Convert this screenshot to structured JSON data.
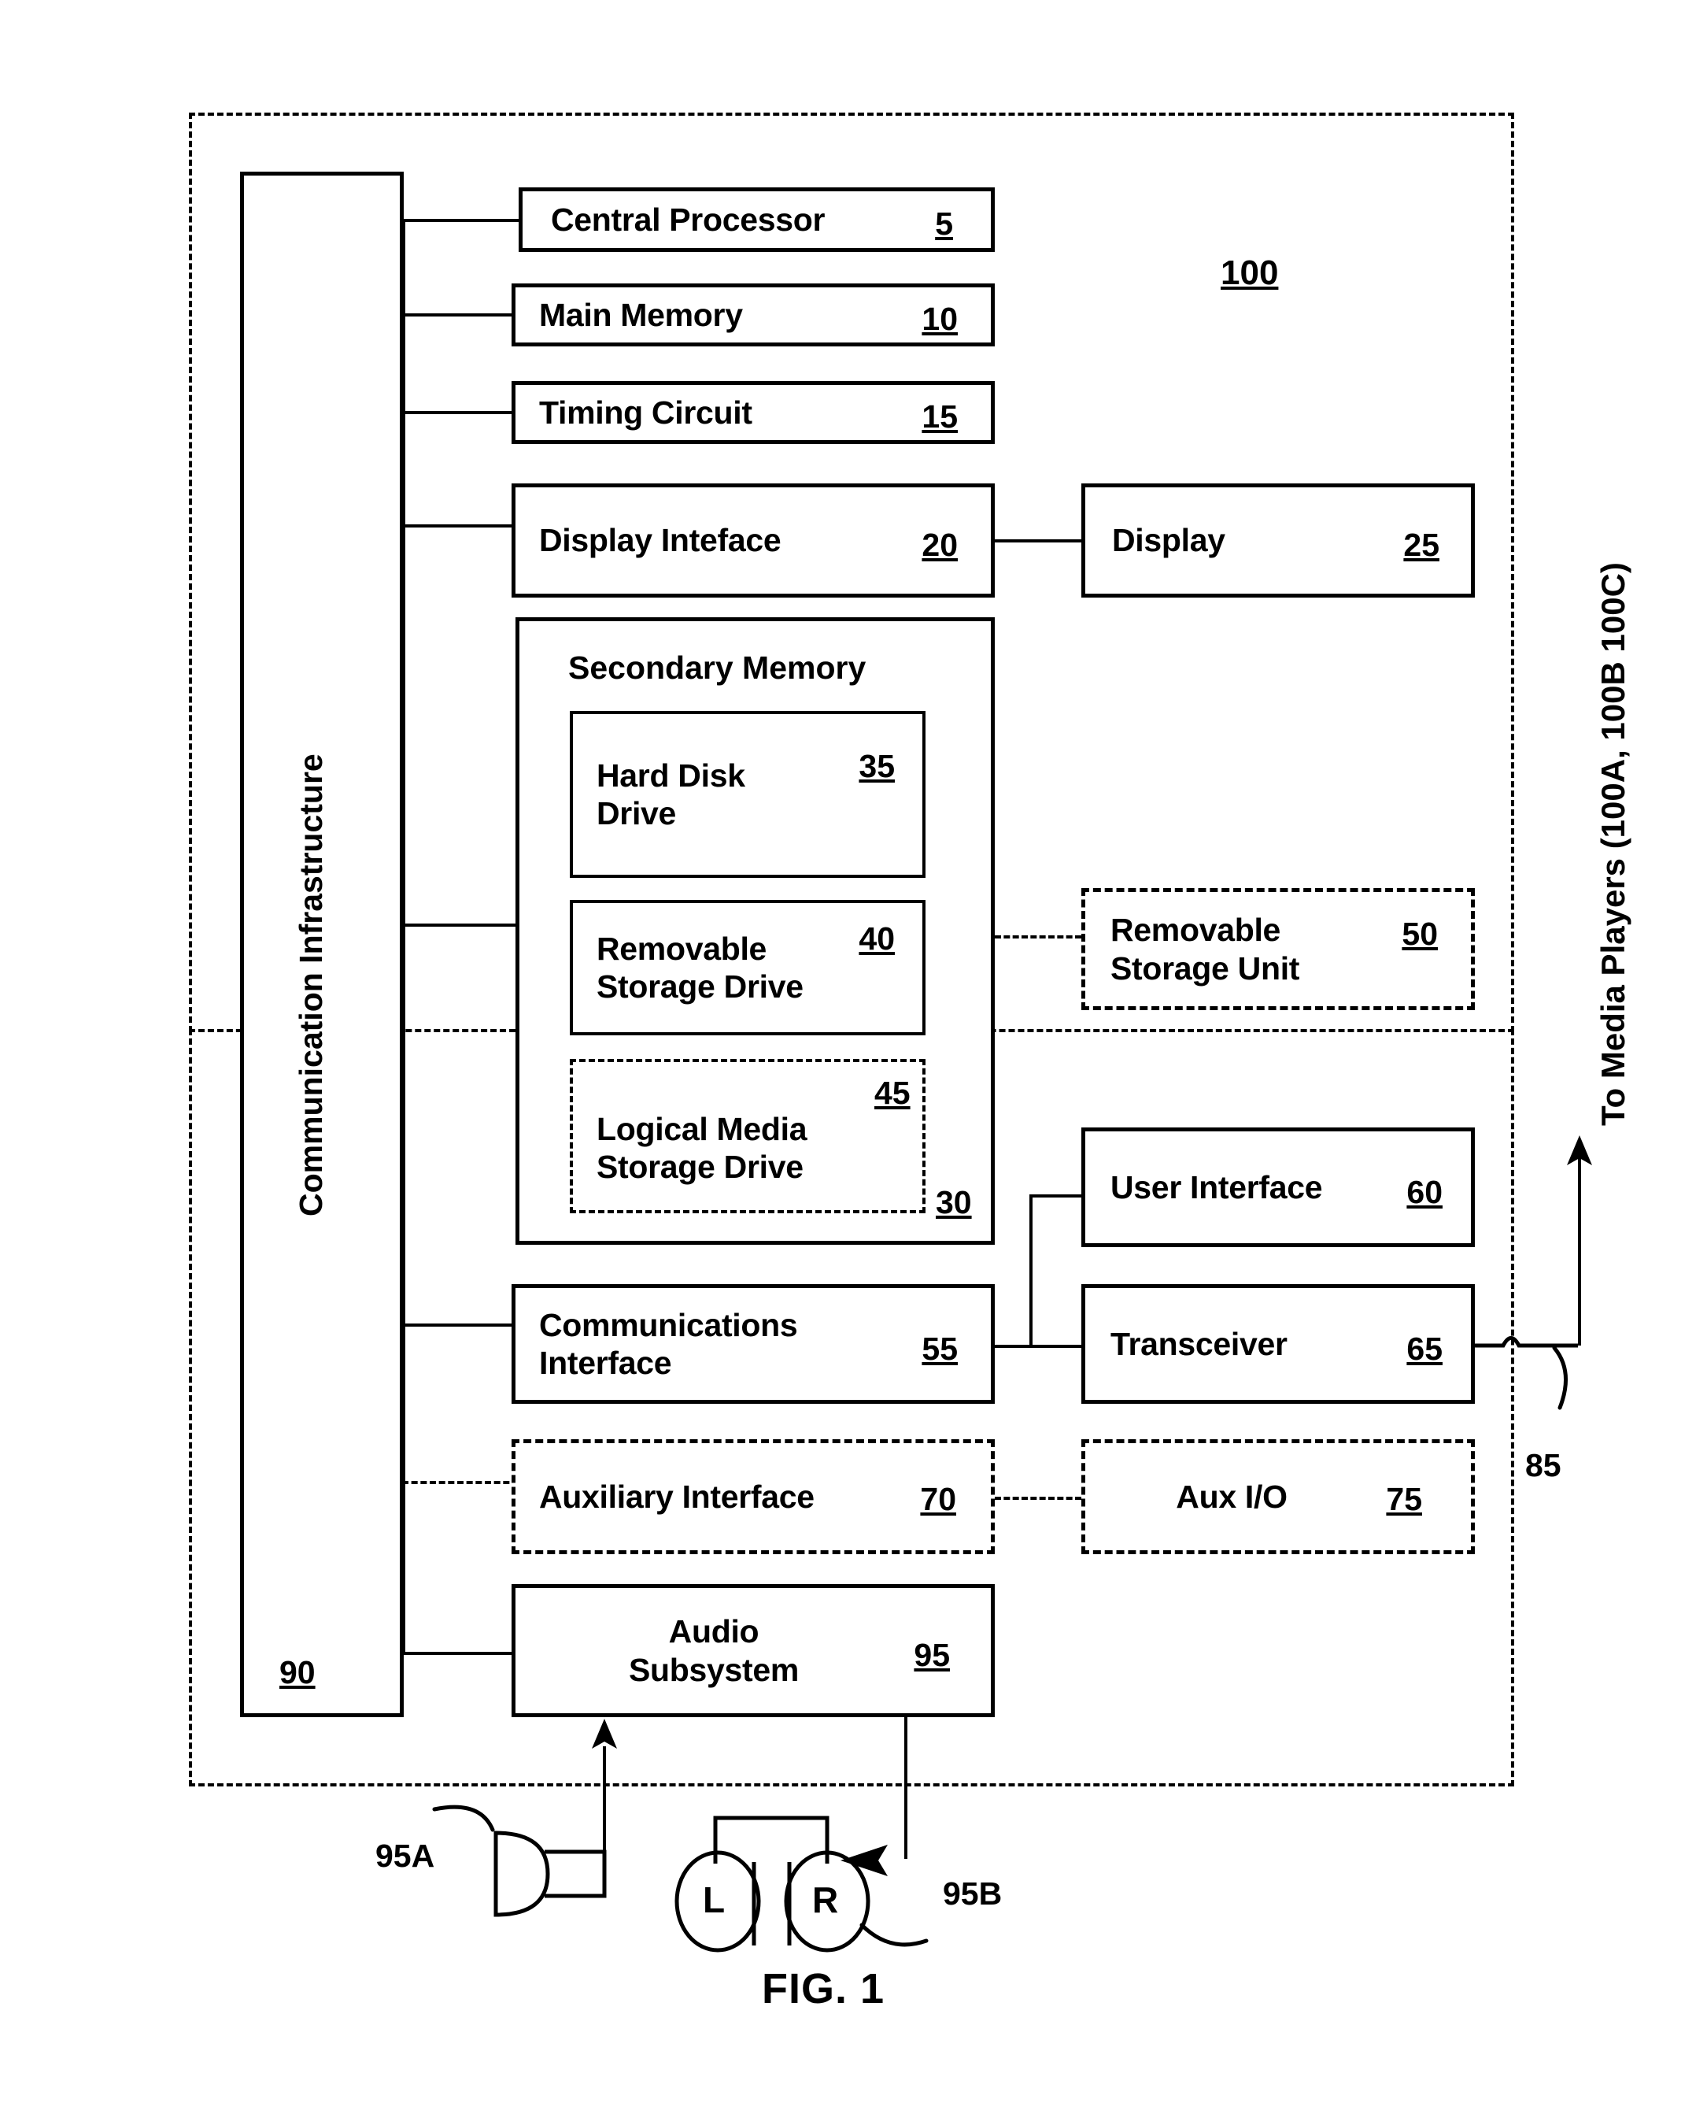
{
  "figure": {
    "caption": "FIG. 1",
    "system_ref": "100",
    "bus_label": "Communication Infrastructure",
    "bus_ref": "90",
    "external_label": "To Media Players (100A, 100B 100C)",
    "link_ref": "85"
  },
  "blocks": {
    "central_processor": {
      "label": "Central Processor",
      "ref": "5",
      "style": "solid"
    },
    "main_memory": {
      "label": "Main Memory",
      "ref": "10",
      "style": "solid"
    },
    "timing_circuit": {
      "label": "Timing Circuit",
      "ref": "15",
      "style": "solid"
    },
    "display_interface": {
      "label": "Display Inteface",
      "ref": "20",
      "style": "solid"
    },
    "display": {
      "label": "Display",
      "ref": "25",
      "style": "solid"
    },
    "secondary_memory": {
      "label": "Secondary Memory",
      "ref": "30",
      "style": "solid"
    },
    "hard_disk_drive": {
      "label": "Hard Disk\nDrive",
      "ref": "35",
      "style": "solid"
    },
    "removable_storage_drive": {
      "label": "Removable\nStorage Drive",
      "ref": "40",
      "style": "solid"
    },
    "logical_media_storage_drive": {
      "label": "Logical Media\nStorage Drive",
      "ref": "45",
      "style": "dashed"
    },
    "removable_storage_unit": {
      "label": "Removable\nStorage Unit",
      "ref": "50",
      "style": "dashed"
    },
    "communications_interface": {
      "label": "Communications\nInterface",
      "ref": "55",
      "style": "solid"
    },
    "user_interface": {
      "label": "User Interface",
      "ref": "60",
      "style": "solid"
    },
    "transceiver": {
      "label": "Transceiver",
      "ref": "65",
      "style": "solid"
    },
    "auxiliary_interface": {
      "label": "Auxiliary Interface",
      "ref": "70",
      "style": "dashed"
    },
    "aux_io": {
      "label": "Aux I/O",
      "ref": "75",
      "style": "dashed"
    },
    "audio_subsystem": {
      "label": "Audio\nSubsystem",
      "ref": "95",
      "style": "solid"
    }
  },
  "peripherals": {
    "microphone": {
      "ref": "95A",
      "icon": "microphone-icon"
    },
    "headphones": {
      "ref": "95B",
      "icon": "headphones-icon",
      "left_label": "L",
      "right_label": "R"
    }
  }
}
